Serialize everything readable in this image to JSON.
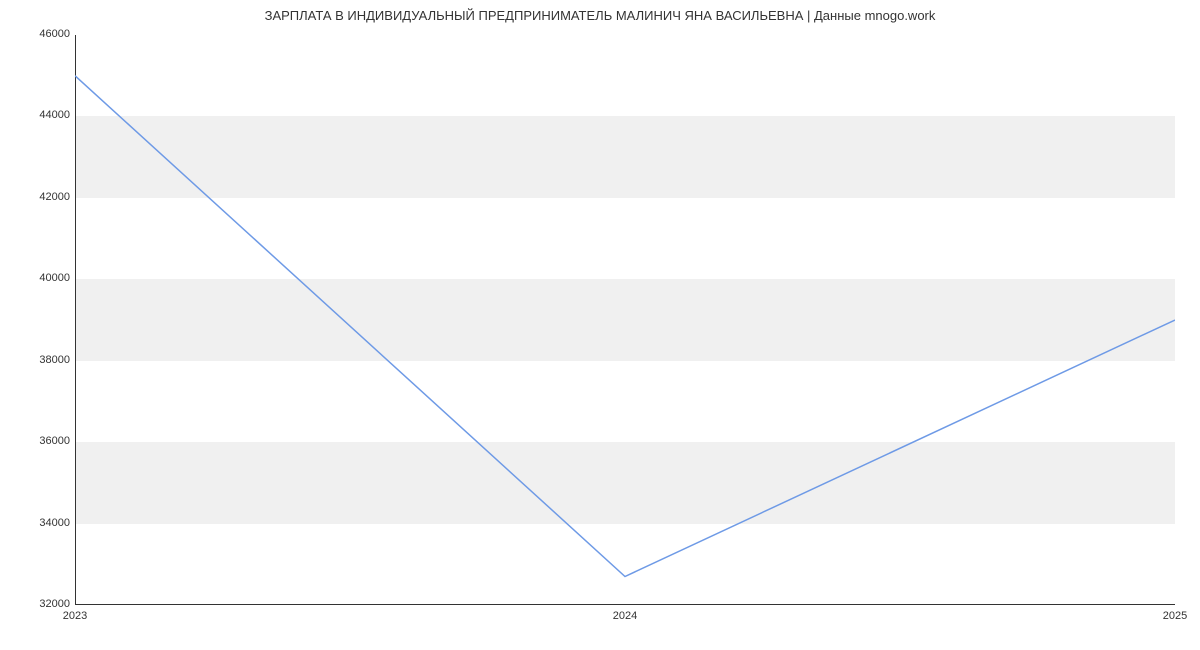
{
  "title": "ЗАРПЛАТА В ИНДИВИДУАЛЬНЫЙ ПРЕДПРИНИМАТЕЛЬ МАЛИНИЧ ЯНА ВАСИЛЬЕВНА | Данные mnogo.work",
  "chart_data": {
    "type": "line",
    "x": [
      2023,
      2024,
      2025
    ],
    "values": [
      45000,
      32700,
      39000
    ],
    "title": "ЗАРПЛАТА В ИНДИВИДУАЛЬНЫЙ ПРЕДПРИНИМАТЕЛЬ МАЛИНИЧ ЯНА ВАСИЛЬЕВНА | Данные mnogo.work",
    "xlabel": "",
    "ylabel": "",
    "xlim": [
      2023,
      2025
    ],
    "ylim": [
      32000,
      46000
    ],
    "y_ticks": [
      32000,
      34000,
      36000,
      38000,
      40000,
      42000,
      44000,
      46000
    ],
    "x_ticks": [
      2023,
      2024,
      2025
    ],
    "line_color": "#6e9ae6"
  }
}
